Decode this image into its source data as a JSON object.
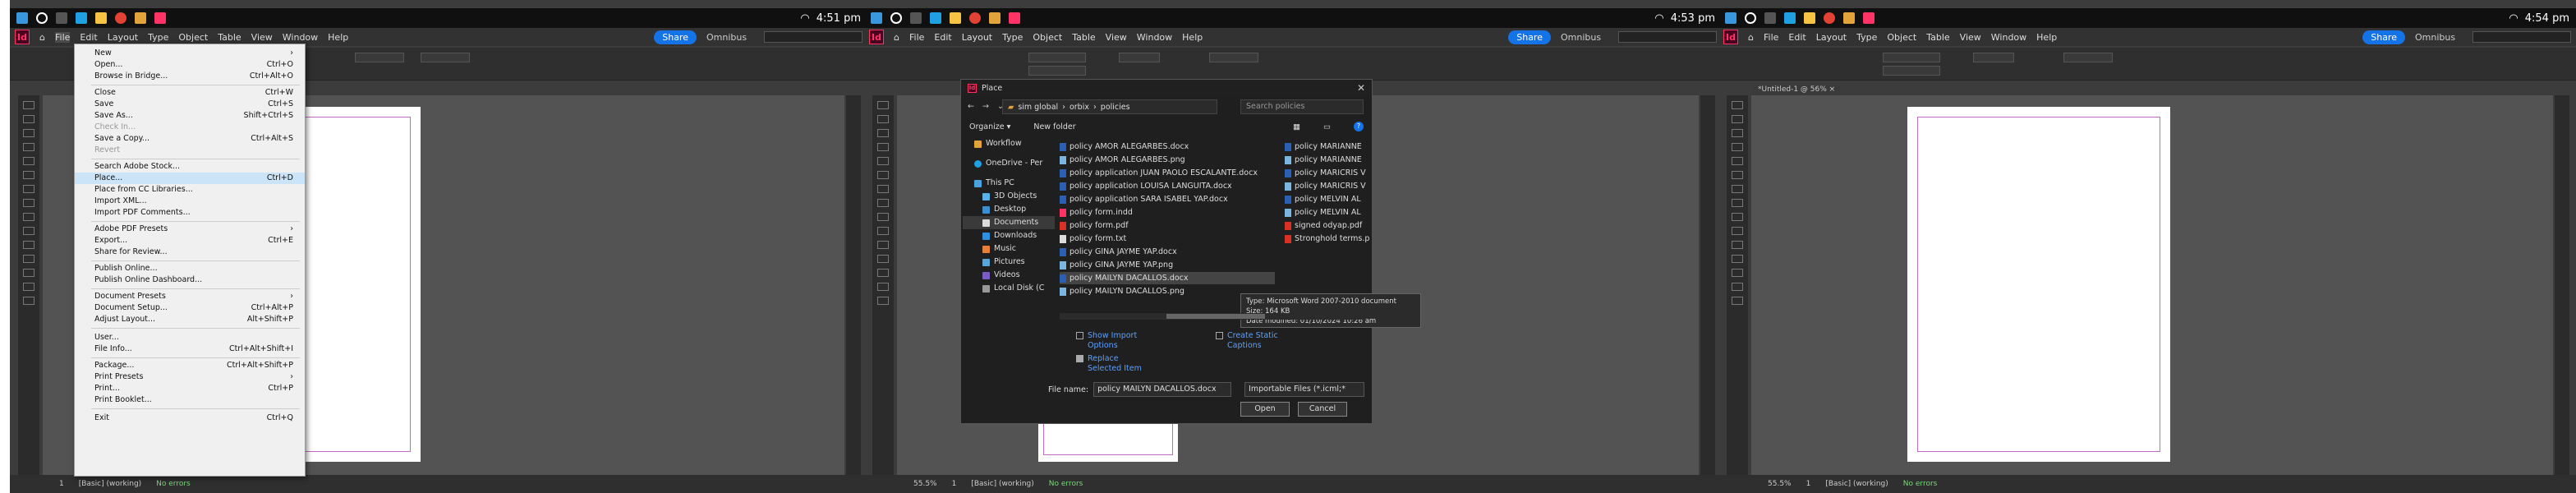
{
  "common": {
    "menubar": [
      "File",
      "Edit",
      "Layout",
      "Type",
      "Object",
      "Table",
      "View",
      "Window",
      "Help"
    ],
    "share_label": "Share",
    "workspace_label": "Omnibus",
    "doc_tab": "*Untitled-1 @ 56% ×",
    "status": {
      "page": "1",
      "style": "[Basic] (working)",
      "errors": "No errors"
    },
    "accent": "#1473e6"
  },
  "panels": [
    {
      "time": "4:51 pm",
      "zoom": ""
    },
    {
      "time": "4:53 pm",
      "zoom": "55.5%"
    },
    {
      "time": "4:54 pm",
      "zoom": "55.5%"
    }
  ],
  "file_menu": {
    "items": [
      {
        "label": "New",
        "shortcut": ""
      },
      {
        "label": "Open...",
        "shortcut": "Ctrl+O"
      },
      {
        "label": "Browse in Bridge...",
        "shortcut": "Ctrl+Alt+O"
      },
      {
        "label": "Close",
        "shortcut": "Ctrl+W"
      },
      {
        "label": "Save",
        "shortcut": "Ctrl+S"
      },
      {
        "label": "Save As...",
        "shortcut": "Shift+Ctrl+S"
      },
      {
        "label": "Check In...",
        "shortcut": ""
      },
      {
        "label": "Save a Copy...",
        "shortcut": "Ctrl+Alt+S"
      },
      {
        "label": "Revert",
        "shortcut": ""
      },
      {
        "label": "Search Adobe Stock...",
        "shortcut": ""
      },
      {
        "label": "Place...",
        "shortcut": "Ctrl+D"
      },
      {
        "label": "Place from CC Libraries...",
        "shortcut": ""
      },
      {
        "label": "Import XML...",
        "shortcut": ""
      },
      {
        "label": "Import PDF Comments...",
        "shortcut": ""
      },
      {
        "label": "Adobe PDF Presets",
        "shortcut": ""
      },
      {
        "label": "Export...",
        "shortcut": "Ctrl+E"
      },
      {
        "label": "Share for Review...",
        "shortcut": ""
      },
      {
        "label": "Publish Online...",
        "shortcut": ""
      },
      {
        "label": "Publish Online Dashboard...",
        "shortcut": ""
      },
      {
        "label": "Document Presets",
        "shortcut": ""
      },
      {
        "label": "Document Setup...",
        "shortcut": "Ctrl+Alt+P"
      },
      {
        "label": "Adjust Layout...",
        "shortcut": "Alt+Shift+P"
      },
      {
        "label": "User...",
        "shortcut": ""
      },
      {
        "label": "File Info...",
        "shortcut": "Ctrl+Alt+Shift+I"
      },
      {
        "label": "Package...",
        "shortcut": "Ctrl+Alt+Shift+P"
      },
      {
        "label": "Print Presets",
        "shortcut": ""
      },
      {
        "label": "Print...",
        "shortcut": "Ctrl+P"
      },
      {
        "label": "Print Booklet...",
        "shortcut": ""
      },
      {
        "label": "Exit",
        "shortcut": "Ctrl+Q"
      }
    ]
  },
  "place_dialog": {
    "title": "Place",
    "breadcrumb": [
      "sim global",
      "orbix",
      "policies"
    ],
    "search_placeholder": "Search policies",
    "organize": "Organize ▾",
    "new_folder": "New folder",
    "nav": [
      "Workflow",
      "OneDrive - Per",
      "This PC",
      "3D Objects",
      "Desktop",
      "Documents",
      "Downloads",
      "Music",
      "Pictures",
      "Videos",
      "Local Disk (C"
    ],
    "files_col1": [
      "policy AMOR ALEGARBES.docx",
      "policy AMOR ALEGARBES.png",
      "policy application JUAN PAOLO ESCALANTE.docx",
      "policy application LOUISA LANGUITA.docx",
      "policy application SARA ISABEL YAP.docx",
      "policy form.indd",
      "policy form.pdf",
      "policy form.txt",
      "policy GINA JAYME YAP.docx",
      "policy GINA JAYME YAP.png",
      "policy MAILYN DACALLOS.docx",
      "policy MAILYN DACALLOS.png"
    ],
    "files_col2": [
      "policy MARIANNE",
      "policy MARIANNE",
      "policy MARICRIS V",
      "policy MARICRIS V",
      "policy MELVIN AL",
      "policy MELVIN AL",
      "signed odyap.pdf",
      "Stronghold terms.p"
    ],
    "tooltip": {
      "type": "Type: Microsoft Word 2007-2010 document",
      "size": "Size: 164 KB",
      "modified": "Date modified: 01/10/2024 10:26 am"
    },
    "options": {
      "show_import": "Show Import Options",
      "replace_selected": "Replace Selected Item",
      "create_static": "Create Static Captions"
    },
    "file_name_label": "File name:",
    "file_name_value": "policy MAILYN DACALLOS.docx",
    "file_type": "Importable Files (*.icml;*",
    "open_label": "Open",
    "cancel_label": "Cancel"
  }
}
